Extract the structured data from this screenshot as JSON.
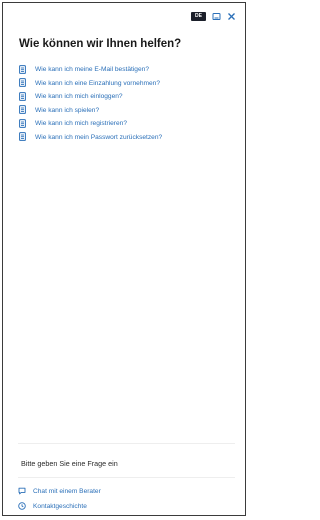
{
  "header": {
    "language_badge": "DE",
    "title": "Wie können wir Ihnen helfen?"
  },
  "faq": {
    "items": [
      {
        "label": "Wie kann ich meine E-Mail bestätigen?",
        "icon": "article-icon"
      },
      {
        "label": "Wie kann ich eine Einzahlung vornehmen?",
        "icon": "article-icon"
      },
      {
        "label": "Wie kann ich mich einloggen?",
        "icon": "article-icon"
      },
      {
        "label": "Wie kann ich spielen?",
        "icon": "article-icon"
      },
      {
        "label": "Wie kann ich mich registrieren?",
        "icon": "article-icon"
      },
      {
        "label": "Wie kann ich mein Passwort zurücksetzen?",
        "icon": "article-icon"
      }
    ]
  },
  "search": {
    "placeholder": "Bitte geben Sie eine Frage ein"
  },
  "footer": {
    "chat_label": "Chat mit einem Berater",
    "history_label": "Kontaktgeschichte"
  },
  "colors": {
    "link": "#2a6fb8",
    "badge_bg": "#1b1f2a",
    "close": "#2a6fb8"
  }
}
